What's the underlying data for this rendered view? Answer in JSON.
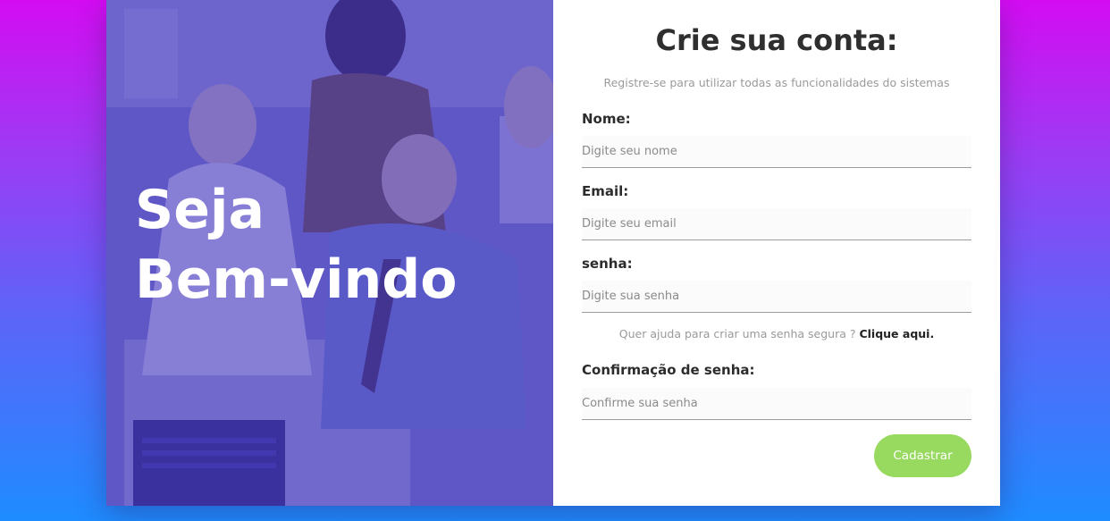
{
  "hero": {
    "line1": "Seja",
    "line2": "Bem-vindo"
  },
  "form": {
    "title": "Crie sua conta:",
    "subtitle": "Registre-se para utilizar todas as funcionalidades do sistemas",
    "fields": [
      {
        "label": "Nome:",
        "placeholder": "Digite seu nome"
      },
      {
        "label": "Email:",
        "placeholder": "Digite seu email"
      },
      {
        "label": "senha:",
        "placeholder": "Digite sua senha"
      },
      {
        "label": "Confirmação de senha:",
        "placeholder": "Confirme sua senha"
      }
    ],
    "help_text": "Quer ajuda para criar uma senha segura ?",
    "help_link": "Clique aqui.",
    "submit_label": "Cadastrar"
  },
  "colors": {
    "gradient_top": "#d40cf2",
    "gradient_bottom": "#1e8cff",
    "hero_overlay": "#3c30be",
    "button": "#98d95f"
  }
}
